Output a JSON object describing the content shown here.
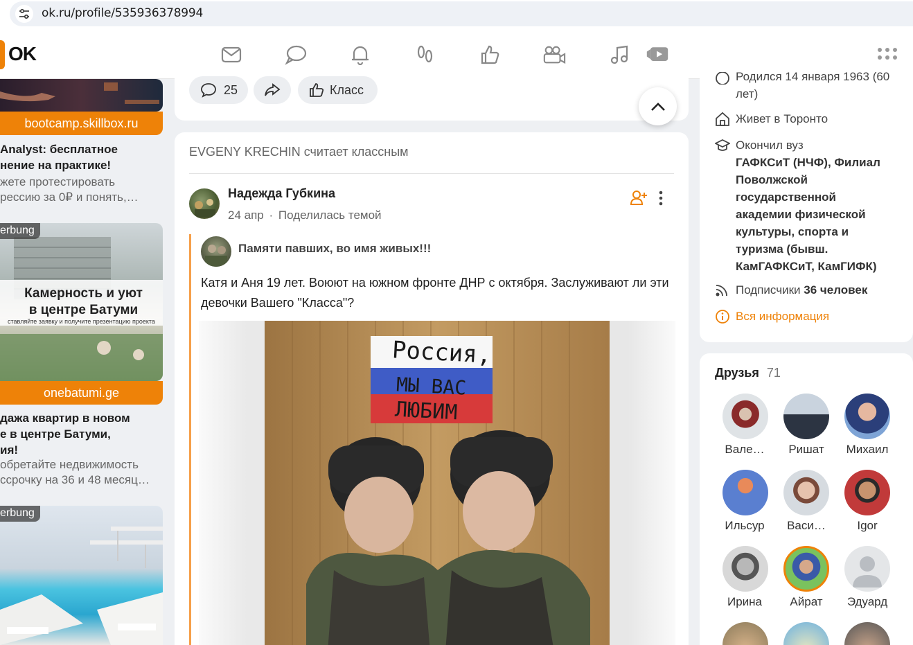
{
  "browser": {
    "url": "ok.ru/profile/535936378994"
  },
  "header": {
    "logo_text": "OK",
    "nav_icons": [
      "mail-icon",
      "chat-icon",
      "bell-icon",
      "footprints-icon",
      "like-icon",
      "video-camera-icon",
      "music-icon",
      "video-play-icon",
      "apps-grid-icon"
    ],
    "accent_color": "#ee8208"
  },
  "ads": [
    {
      "url": "bootcamp.skillbox.ru",
      "title": "Analyst: бесплатное",
      "title2": "нение на практике!",
      "desc1": "жете протестировать",
      "desc2": "рессию за 0₽ и понять,…"
    },
    {
      "badge": "erbung",
      "overlay_title1": "Камерность и уют",
      "overlay_title2": "в центре Батуми",
      "overlay_sub": "ставляйте заявку и получите презентацию проекта",
      "url": "onebatumi.ge",
      "title": "дажа квартир в новом",
      "title2": "е в центре Батуми,",
      "title3": "ия!",
      "desc1": "обретайте недвижимость",
      "desc2": "ссрочку на 36 и 48 месяц…"
    },
    {
      "badge": "erbung"
    }
  ],
  "prev_post_actions": {
    "comments_count": "25",
    "class_label": "Класс"
  },
  "post": {
    "activity_user": "EVGENY KRECHIN",
    "activity_text": "считает классным",
    "author": "Надежда Губкина",
    "date": "24 апр",
    "share_text": "Поделилась темой",
    "group_name": "Памяти павших, во имя живых!!!",
    "text": "Катя и Аня 19 лет. Воюют на южном фронте ДНР с октября. Заслуживают ли эти девочки Вашего \"Класса\"?",
    "photo_poster_line1": "Россия,",
    "photo_poster_line2": "МЫ ВАС",
    "photo_poster_line3": "ЛЮБИМ"
  },
  "profile_info": {
    "born_text": "Родился 14 января 1963 (60",
    "born_text2": "лет)",
    "lives_label": "Живет в",
    "lives_city": "Торонто",
    "edu_label": "Окончил вуз",
    "edu_lines": [
      "ГАФКСиТ (НЧФ), Филиал",
      "Поволжской",
      "государственной",
      "академии физической",
      "культуры, спорта и",
      "туризма (бывш.",
      "КамГАФКСиТ, КамГИФК)"
    ],
    "subs_label": "Подписчики",
    "subs_value": "36 человек",
    "all_info": "Вся информация"
  },
  "friends": {
    "title": "Друзья",
    "count": "71",
    "items": [
      {
        "name": "Вале…"
      },
      {
        "name": "Ришат"
      },
      {
        "name": "Михаил"
      },
      {
        "name": "Ильсур"
      },
      {
        "name": "Васи…"
      },
      {
        "name": "Igor"
      },
      {
        "name": "Ирина"
      },
      {
        "name": "Айрат"
      },
      {
        "name": "Эдуард"
      }
    ]
  }
}
